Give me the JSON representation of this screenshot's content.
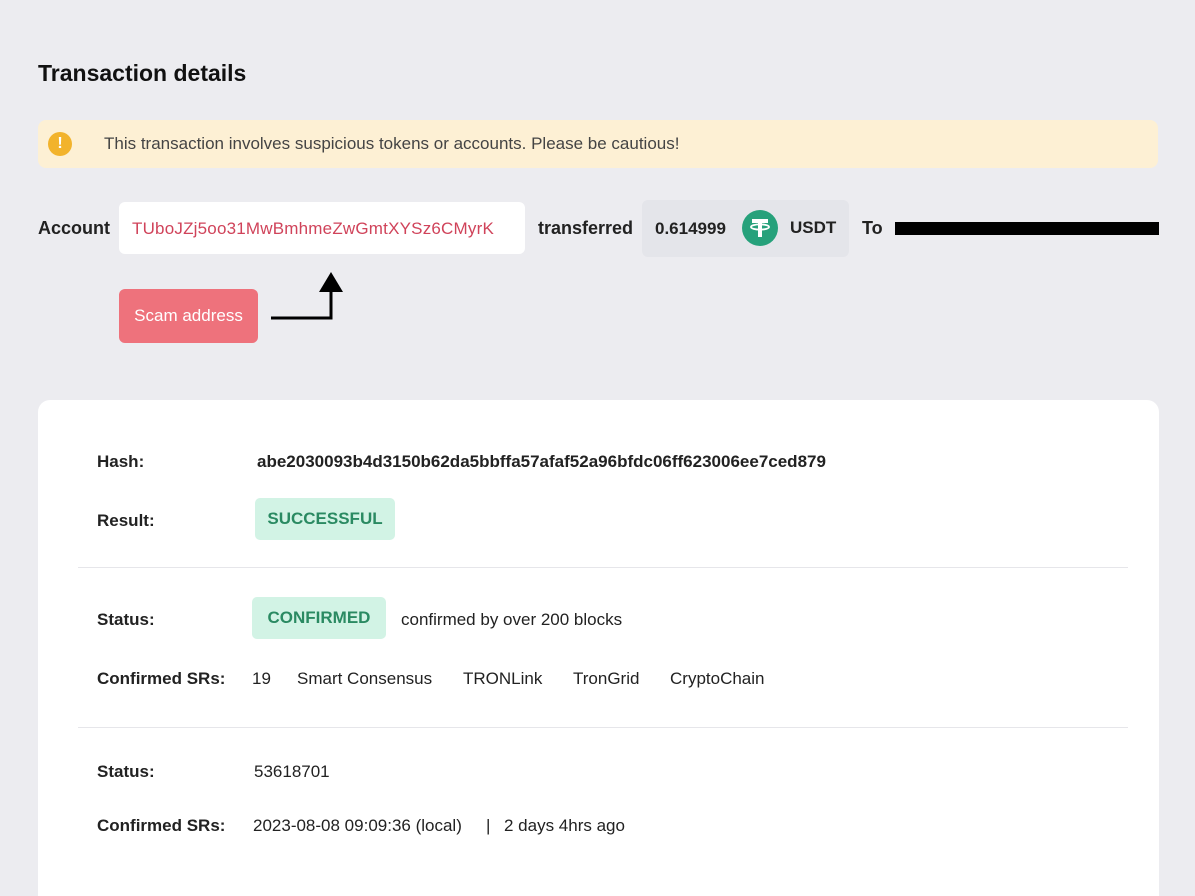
{
  "page": {
    "title": "Transaction details"
  },
  "warning": {
    "icon": "exclamation-icon",
    "icon_glyph": "!",
    "text": "This transaction involves suspicious tokens or accounts. Please be cautious!"
  },
  "transfer": {
    "account_label": "Account",
    "account_address": "TUboJZj5oo31MwBmhmeZwGmtXYSz6CMyrK",
    "transferred_label": "transferred",
    "amount": "0.614999",
    "token_icon": "tether-icon",
    "token_symbol": "USDT",
    "to_label": "To"
  },
  "annotation": {
    "scam_label": "Scam address",
    "arrow_icon": "bent-arrow-icon"
  },
  "details": {
    "hash_label": "Hash:",
    "hash_value": "abe2030093b4d3150b62da5bbffa57afaf52a96bfdc06ff623006ee7ced879",
    "result_label": "Result:",
    "result_badge": "SUCCESSFUL",
    "status_label": "Status:",
    "status_badge": "CONFIRMED",
    "status_note": "confirmed by over 200 blocks",
    "confirmed_srs_label": "Confirmed SRs:",
    "confirmed_srs_count": "19",
    "confirmed_srs_list": [
      "Smart Consensus",
      "TRONLink",
      "TronGrid",
      "CryptoChain"
    ],
    "block_label": "Status:",
    "block_value": "53618701",
    "time_label": "Confirmed SRs:",
    "time_value": "2023-08-08 09:09:36 (local)",
    "time_separator": "|",
    "time_ago": "2 days 4hrs ago"
  },
  "colors": {
    "background": "#ececf0",
    "warning_bg": "#fdf0d4",
    "warning_icon": "#f2b32c",
    "scam_address_text": "#d0435a",
    "scam_button": "#ee727c",
    "tether": "#26a17b",
    "badge_bg": "#d2f3e5",
    "badge_text": "#2a8a62"
  }
}
